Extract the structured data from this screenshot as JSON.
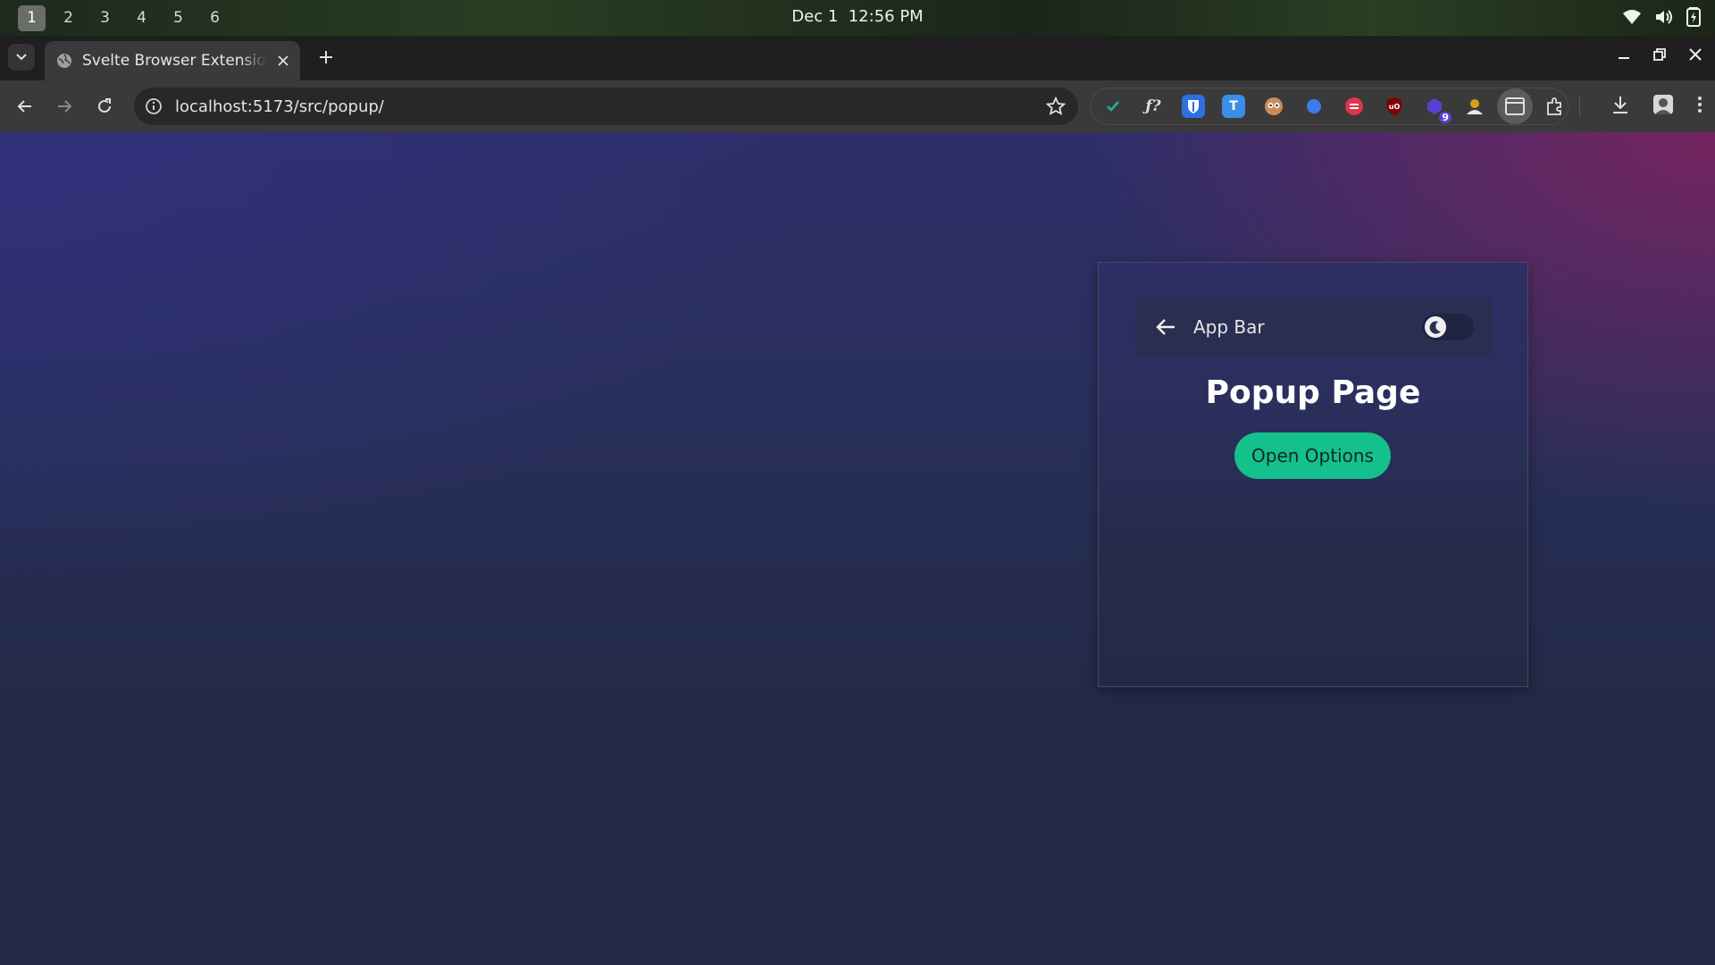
{
  "os_bar": {
    "workspaces": [
      "1",
      "2",
      "3",
      "4",
      "5",
      "6"
    ],
    "active_workspace": "1",
    "date": "Dec 1",
    "time": "12:56 PM",
    "tray_icons": [
      "wifi-icon",
      "volume-icon",
      "battery-icon"
    ]
  },
  "browser": {
    "tab": {
      "title": "Svelte Browser Extension",
      "favicon": "globe-icon"
    },
    "address": {
      "url": "localhost:5173/src/popup/"
    },
    "extensions": [
      {
        "name": "check-extension-icon",
        "color": "#1fb59a"
      },
      {
        "name": "formula-extension-icon",
        "color": "#e0e0e0"
      },
      {
        "name": "bitwarden-extension-icon",
        "color": "#2f6fe0"
      },
      {
        "name": "translate-extension-icon",
        "color": "#3a8ee6"
      },
      {
        "name": "privacy-badger-extension-icon",
        "color": "#c98c5a"
      },
      {
        "name": "blue-dot-extension-icon",
        "color": "#3d7de8"
      },
      {
        "name": "red-extension-icon",
        "color": "#e0334f"
      },
      {
        "name": "ublock-origin-extension-icon",
        "color": "#800000"
      },
      {
        "name": "purple-extension-icon",
        "color": "#5b3fd1",
        "badge": "9"
      },
      {
        "name": "user-extension-icon",
        "color": "#d4a017"
      },
      {
        "name": "window-extension-icon",
        "color": "#cfcfcf"
      },
      {
        "name": "puzzle-extensions-icon",
        "color": "#cfcfcf"
      }
    ]
  },
  "popup": {
    "app_bar": {
      "title": "App Bar"
    },
    "heading": "Popup Page",
    "open_options_label": "Open Options",
    "accent_color": "#14c08b"
  }
}
